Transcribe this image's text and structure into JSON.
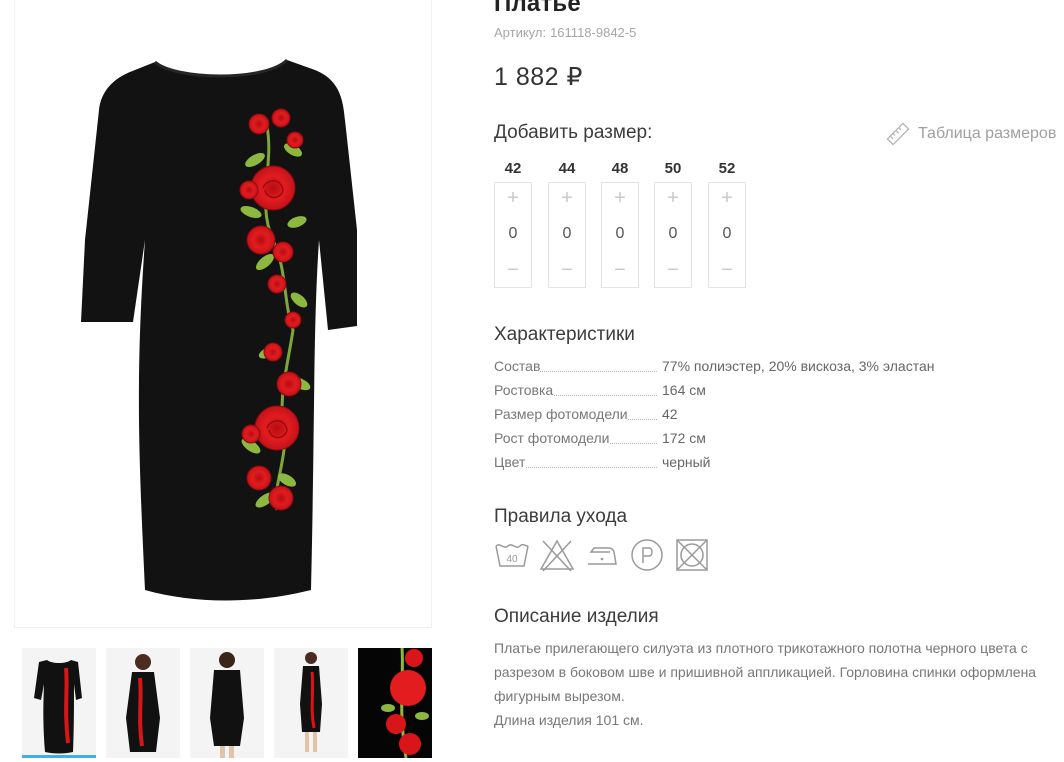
{
  "product": {
    "title": "Платье",
    "sku_label": "Артикул:",
    "sku": "161118-9842-5",
    "price": "1 882 ₽"
  },
  "sizes": {
    "heading": "Добавить размер:",
    "table_link": "Таблица размеров",
    "items": [
      {
        "size": "42",
        "qty": "0",
        "plus": "+",
        "minus": "−"
      },
      {
        "size": "44",
        "qty": "0",
        "plus": "+",
        "minus": "−"
      },
      {
        "size": "48",
        "qty": "0",
        "plus": "+",
        "minus": "−"
      },
      {
        "size": "50",
        "qty": "0",
        "plus": "+",
        "minus": "−"
      },
      {
        "size": "52",
        "qty": "0",
        "plus": "+",
        "minus": "−"
      }
    ]
  },
  "characteristics": {
    "heading": "Характеристики",
    "rows": [
      {
        "key": "Состав",
        "value": "77% полиэстер, 20% вискоза, 3% эластан"
      },
      {
        "key": "Ростовка",
        "value": "164 см"
      },
      {
        "key": "Размер фотомодели",
        "value": "42"
      },
      {
        "key": "Рост фотомодели",
        "value": "172 см"
      },
      {
        "key": "Цвет",
        "value": "черный"
      }
    ]
  },
  "care": {
    "heading": "Правила ухода",
    "icon_labels": {
      "wash": "40"
    },
    "icons": [
      "wash-40-icon",
      "no-bleach-icon",
      "low-iron-icon",
      "dry-clean-p-icon",
      "no-tumble-dry-icon"
    ]
  },
  "description": {
    "heading": "Описание изделия",
    "lines": [
      "Платье прилегающего силуэта из плотного трикотажного полотна черного цвета с",
      "разрезом в боковом шве и пришивной аппликацией. Горловина спинки оформлена",
      "фигурным вырезом.",
      "Длина изделия 101 см."
    ]
  },
  "gallery": {
    "thumbnails": [
      "dress-front",
      "model-front",
      "model-back",
      "model-full",
      "embroidery-closeup"
    ],
    "active_index": 0
  },
  "colors": {
    "accent": "#3db1e5",
    "dress": "#121212",
    "rose": "#d8161a",
    "leaf": "#8cb840"
  }
}
